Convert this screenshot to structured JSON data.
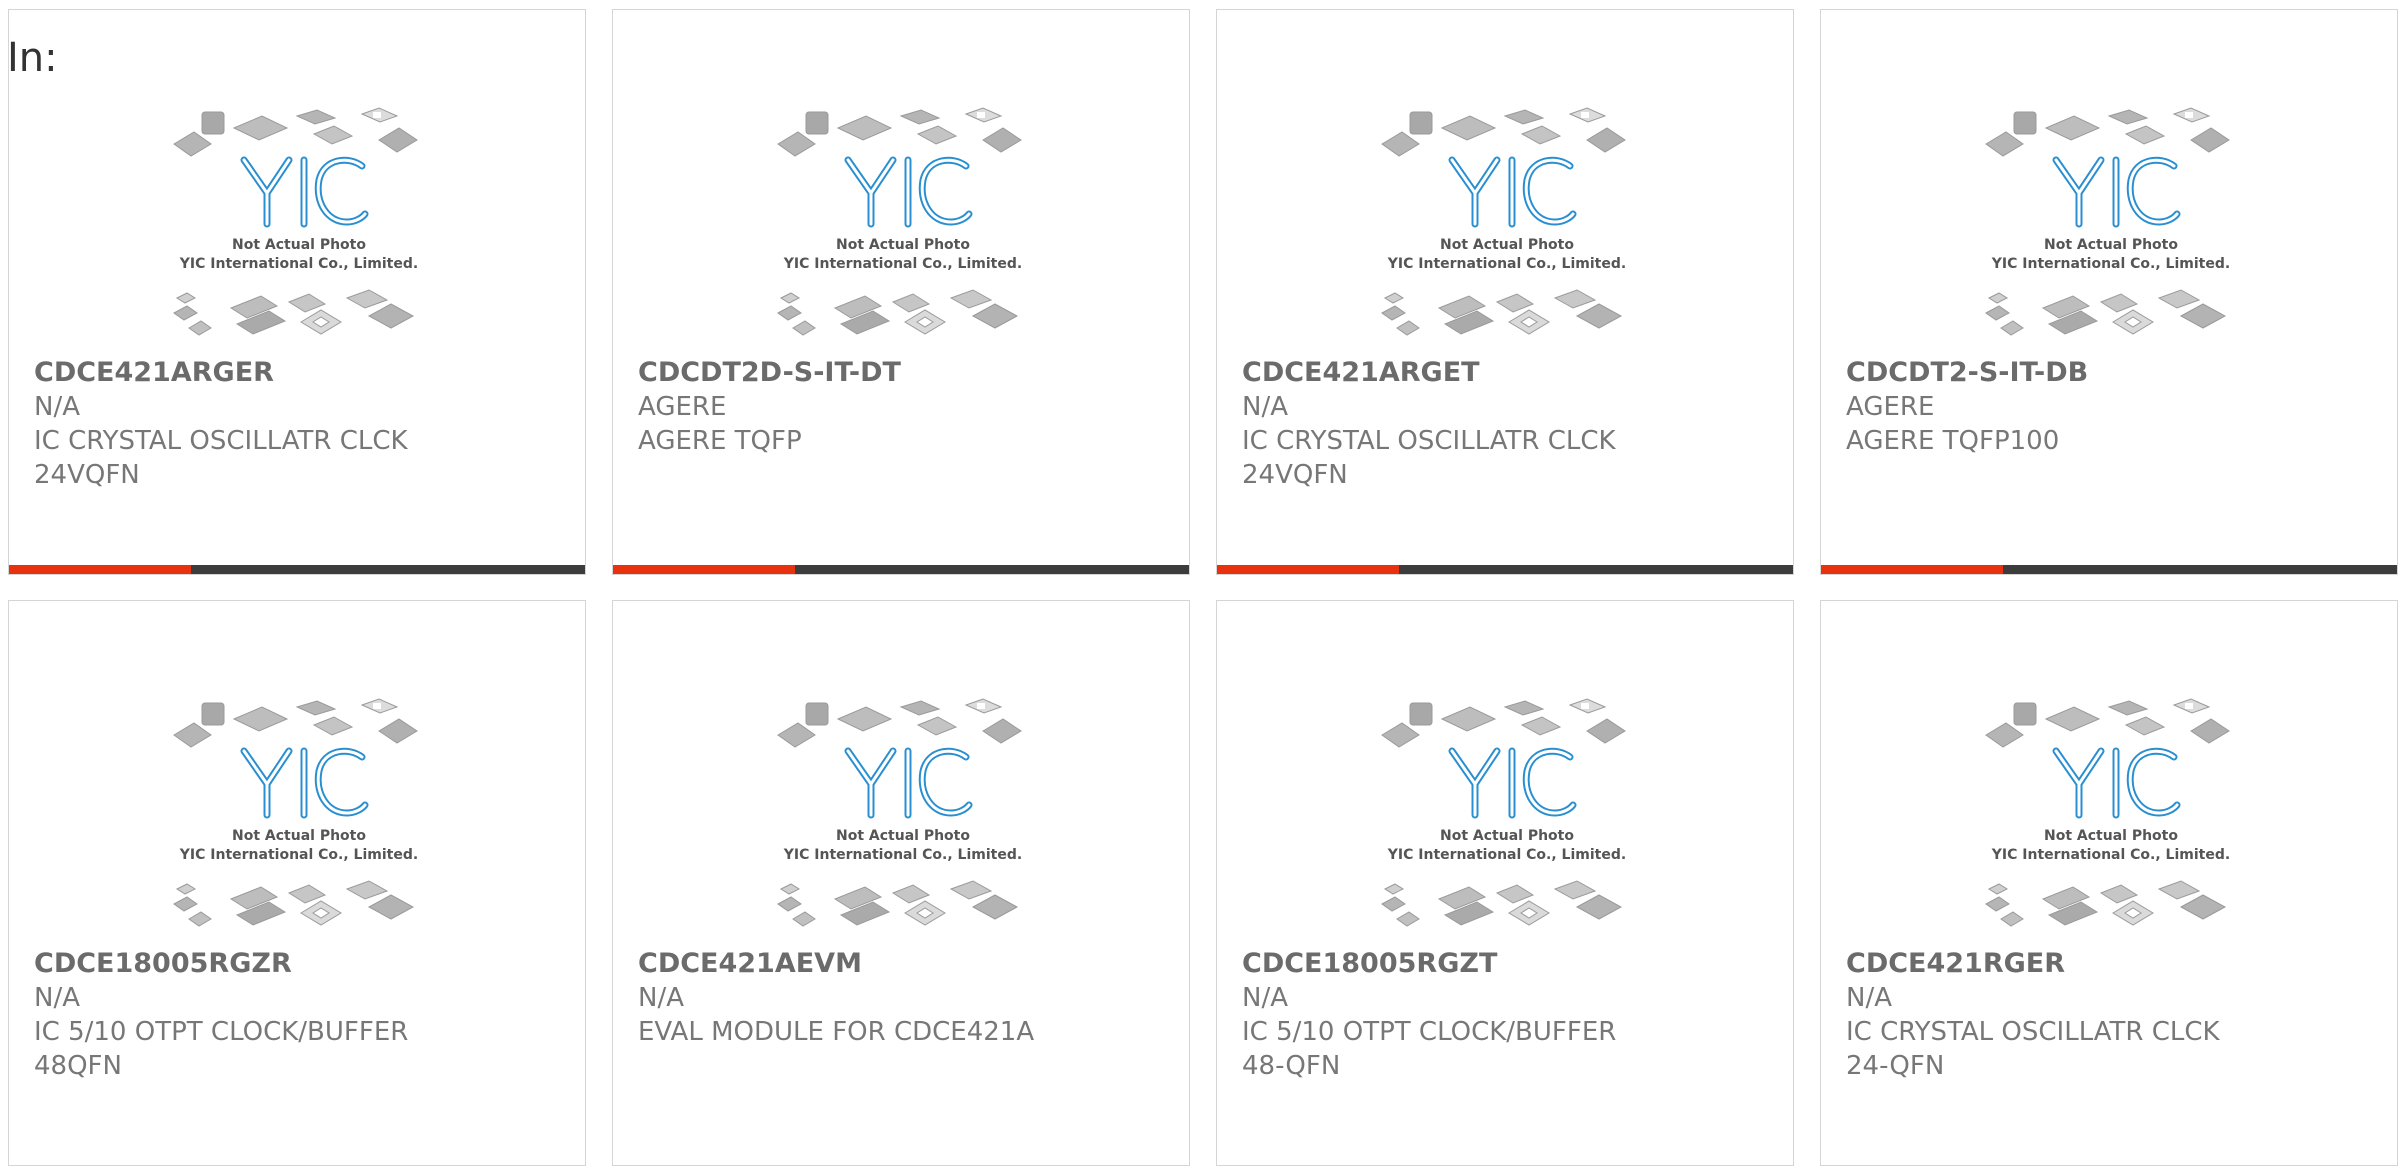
{
  "header": {
    "in_label": "In:"
  },
  "photo": {
    "line1": "Not Actual Photo",
    "line2": "YIC International Co., Limited.",
    "logo": "YIC"
  },
  "colors": {
    "accent": "#e8310e",
    "bar_dark": "#3c3c3c",
    "logo_blue": "#2a8fd0",
    "text_gray": "#777777"
  },
  "products": [
    {
      "part_number": "CDCE421ARGER",
      "manufacturer": "N/A",
      "description": "IC CRYSTAL OSCILLATR CLCK 24VQFN"
    },
    {
      "part_number": "CDCDT2D-S-IT-DT",
      "manufacturer": "AGERE",
      "description": "AGERE TQFP"
    },
    {
      "part_number": "CDCE421ARGET",
      "manufacturer": "N/A",
      "description": "IC CRYSTAL OSCILLATR CLCK 24VQFN"
    },
    {
      "part_number": "CDCDT2-S-IT-DB",
      "manufacturer": "AGERE",
      "description": "AGERE TQFP100"
    },
    {
      "part_number": "CDCE18005RGZR",
      "manufacturer": "N/A",
      "description": "IC 5/10 OTPT CLOCK/BUFFER 48QFN"
    },
    {
      "part_number": "CDCE421AEVM",
      "manufacturer": "N/A",
      "description": "EVAL MODULE FOR CDCE421A"
    },
    {
      "part_number": "CDCE18005RGZT",
      "manufacturer": "N/A",
      "description": "IC 5/10 OTPT CLOCK/BUFFER 48-QFN"
    },
    {
      "part_number": "CDCE421RGER",
      "manufacturer": "N/A",
      "description": "IC CRYSTAL OSCILLATR CLCK 24-QFN"
    }
  ]
}
